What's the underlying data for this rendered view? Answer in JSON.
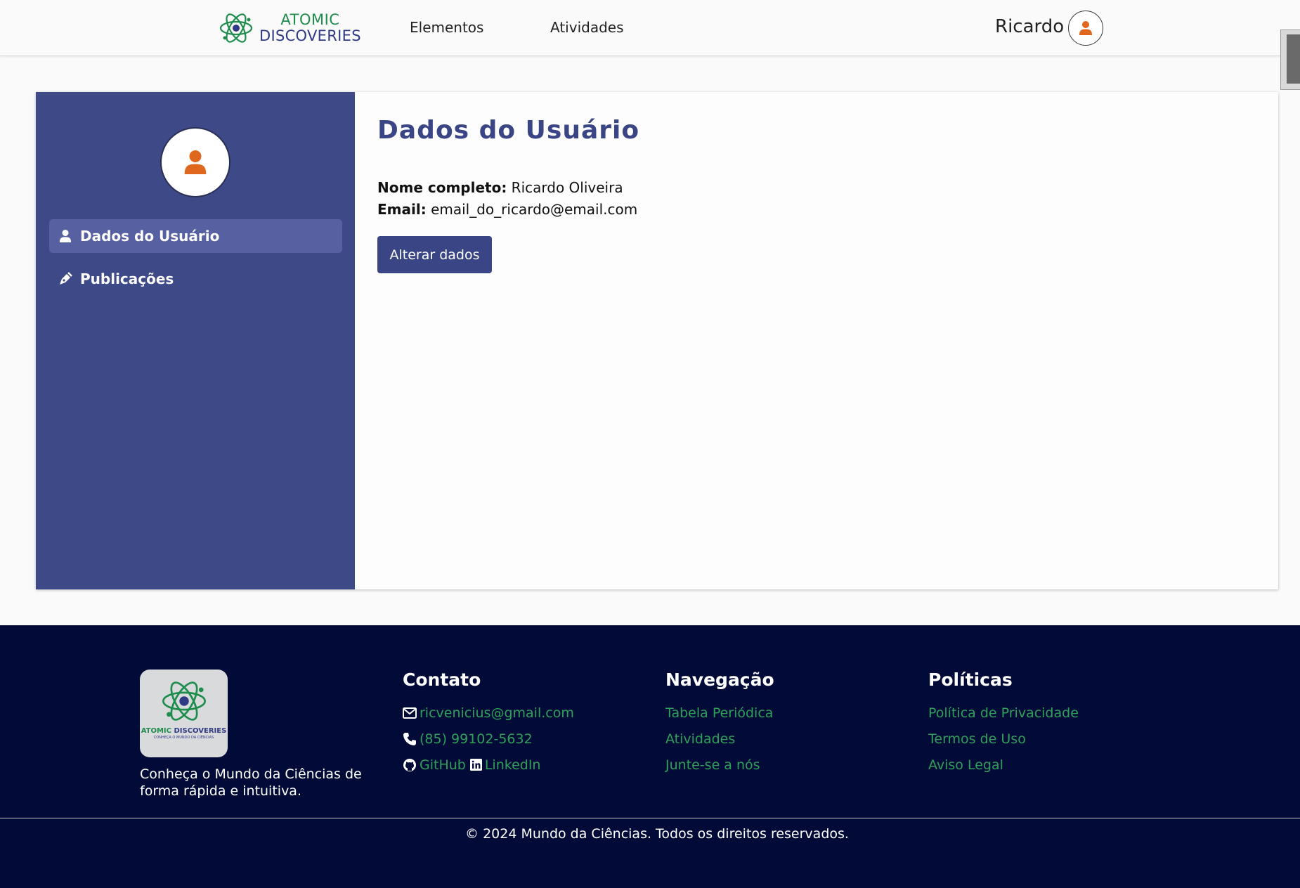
{
  "header": {
    "logo_line1": "ATOMIC",
    "logo_line2": "DISCOVERIES",
    "nav": [
      "Elementos",
      "Atividades"
    ],
    "username": "Ricardo"
  },
  "sidebar": {
    "items": [
      {
        "label": "Dados do Usuário",
        "icon": "user-icon",
        "active": true
      },
      {
        "label": "Publicações",
        "icon": "pen-icon",
        "active": false
      }
    ]
  },
  "main": {
    "title": "Dados do Usuário",
    "name_label": "Nome completo:",
    "name_value": " Ricardo Oliveira",
    "email_label": "Email:",
    "email_value": " email_do_ricardo@email.com",
    "edit_button": "Alterar dados"
  },
  "footer": {
    "logo_text_a": "ATOMIC",
    "logo_text_b": "DISCOVERIES",
    "logo_tagline": "CONHEÇA O MUNDO DA CIÊNCIAS",
    "description": "Conheça o Mundo da Ciências de forma rápida e intuitiva.",
    "contato": {
      "title": "Contato",
      "email": "ricvenicius@gmail.com",
      "phone": "(85) 99102-5632",
      "github": "GitHub",
      "linkedin": "LinkedIn"
    },
    "navegacao": {
      "title": "Navegação",
      "links": [
        "Tabela Periódica",
        "Atividades",
        "Junte-se a nós"
      ]
    },
    "politicas": {
      "title": "Políticas",
      "links": [
        "Política de Privacidade",
        "Termos de Uso",
        "Aviso Legal"
      ]
    },
    "copyright": "© 2024 Mundo da Ciências. Todos os direitos reservados."
  },
  "colors": {
    "primary": "#3e4a87",
    "accent_orange": "#e0681e",
    "footer_bg": "#020b37",
    "link_green": "#2ea05a"
  }
}
